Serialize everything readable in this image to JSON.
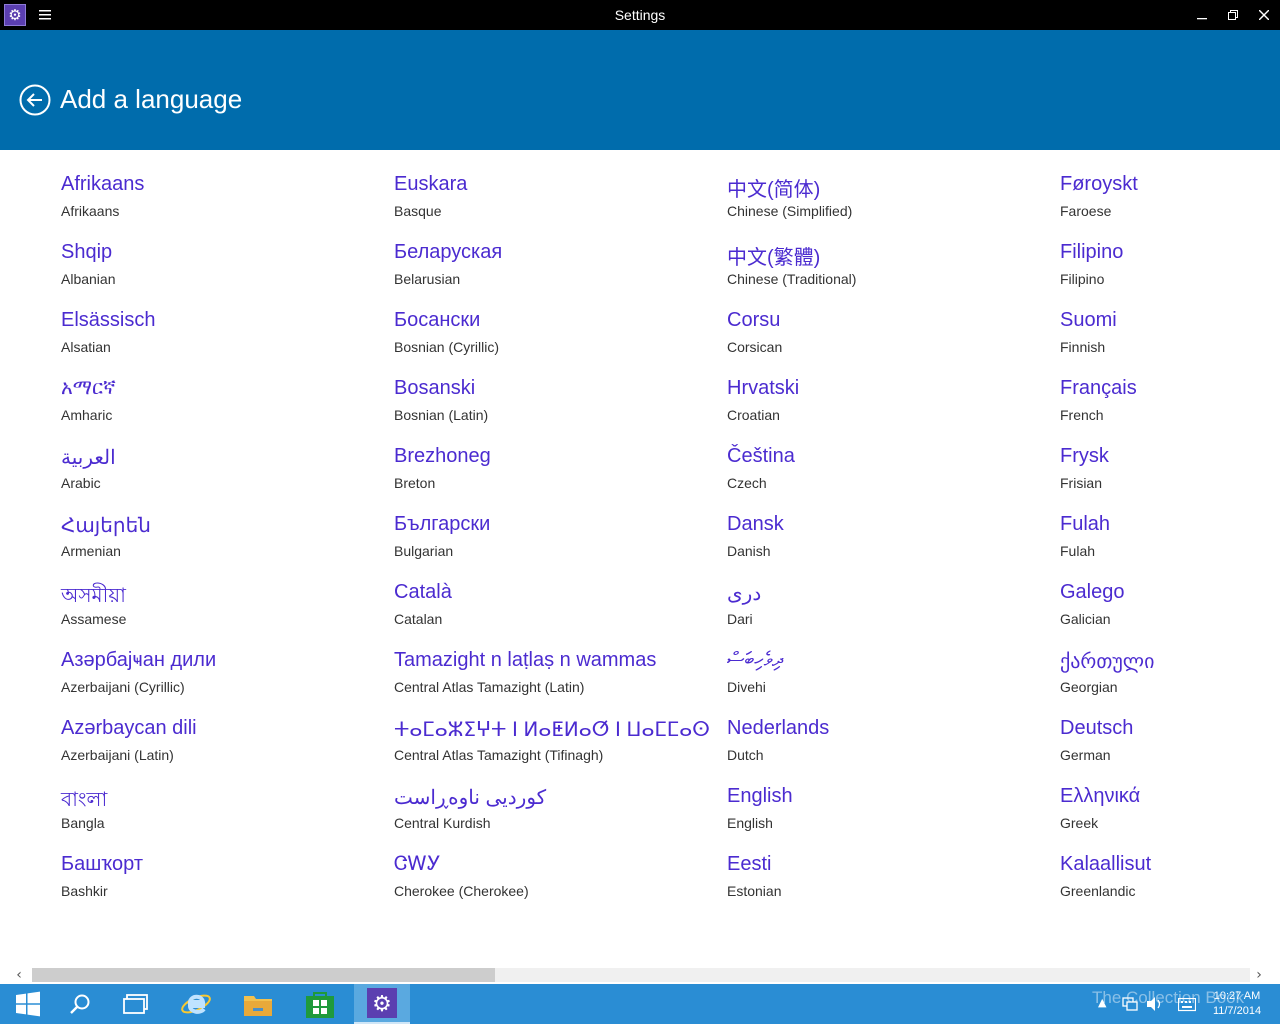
{
  "window": {
    "title": "Settings",
    "menu_icon": "hamburger-menu-icon",
    "app_icon": "gear-icon"
  },
  "header": {
    "title": "Add a language",
    "back_icon": "back-arrow-circle-icon",
    "bg_color": "#006cac"
  },
  "accent_color": "#4b2bd0",
  "languages": [
    {
      "native": "Afrikaans",
      "english": "Afrikaans"
    },
    {
      "native": "Shqip",
      "english": "Albanian"
    },
    {
      "native": "Elsässisch",
      "english": "Alsatian"
    },
    {
      "native": "አማርኛ",
      "english": "Amharic"
    },
    {
      "native": "العربية",
      "english": "Arabic"
    },
    {
      "native": "Հայերեն",
      "english": "Armenian"
    },
    {
      "native": "অসমীয়া",
      "english": "Assamese"
    },
    {
      "native": "Азәрбајҹан дили",
      "english": "Azerbaijani (Cyrillic)"
    },
    {
      "native": "Azərbaycan dili",
      "english": "Azerbaijani (Latin)"
    },
    {
      "native": "বাংলা",
      "english": "Bangla"
    },
    {
      "native": "Башҡорт",
      "english": "Bashkir"
    },
    {
      "native": "Euskara",
      "english": "Basque"
    },
    {
      "native": "Беларуская",
      "english": "Belarusian"
    },
    {
      "native": "Босански",
      "english": "Bosnian (Cyrillic)"
    },
    {
      "native": "Bosanski",
      "english": "Bosnian (Latin)"
    },
    {
      "native": "Brezhoneg",
      "english": "Breton"
    },
    {
      "native": "Български",
      "english": "Bulgarian"
    },
    {
      "native": "Català",
      "english": "Catalan"
    },
    {
      "native": "Tamazight n laṭlaṣ n wammas",
      "english": "Central Atlas Tamazight (Latin)"
    },
    {
      "native": "ⵜⴰⵎⴰⵣⵉⵖⵜ ⵏ ⵍⴰⵟⵍⴰⵚ ⵏ ⵡⴰⵎⵎⴰⵙ",
      "english": "Central Atlas Tamazight (Tifinagh)"
    },
    {
      "native": "کوردیی ناوەڕاست",
      "english": "Central Kurdish"
    },
    {
      "native": "ᏣᎳᎩ",
      "english": "Cherokee (Cherokee)"
    },
    {
      "native": "中文(简体)",
      "english": "Chinese (Simplified)"
    },
    {
      "native": "中文(繁體)",
      "english": "Chinese (Traditional)"
    },
    {
      "native": "Corsu",
      "english": "Corsican"
    },
    {
      "native": "Hrvatski",
      "english": "Croatian"
    },
    {
      "native": "Čeština",
      "english": "Czech"
    },
    {
      "native": "Dansk",
      "english": "Danish"
    },
    {
      "native": "درى",
      "english": "Dari"
    },
    {
      "native": "ދިވެހިބަސް",
      "english": "Divehi"
    },
    {
      "native": "Nederlands",
      "english": "Dutch"
    },
    {
      "native": "English",
      "english": "English"
    },
    {
      "native": "Eesti",
      "english": "Estonian"
    },
    {
      "native": "Føroyskt",
      "english": "Faroese"
    },
    {
      "native": "Filipino",
      "english": "Filipino"
    },
    {
      "native": "Suomi",
      "english": "Finnish"
    },
    {
      "native": "Français",
      "english": "French"
    },
    {
      "native": "Frysk",
      "english": "Frisian"
    },
    {
      "native": "Fulah",
      "english": "Fulah"
    },
    {
      "native": "Galego",
      "english": "Galician"
    },
    {
      "native": "ქართული",
      "english": "Georgian"
    },
    {
      "native": "Deutsch",
      "english": "German"
    },
    {
      "native": "Ελληνικά",
      "english": "Greek"
    },
    {
      "native": "Kalaallisut",
      "english": "Greenlandic"
    }
  ],
  "taskbar": {
    "items": [
      {
        "icon": "windows-start-icon"
      },
      {
        "icon": "search-icon"
      },
      {
        "icon": "task-view-icon"
      },
      {
        "icon": "internet-explorer-icon"
      },
      {
        "icon": "file-explorer-icon"
      },
      {
        "icon": "store-icon"
      },
      {
        "icon": "settings-icon"
      }
    ],
    "time": "10:27 AM",
    "date": "11/7/2014",
    "watermark": "The Collection Book"
  }
}
